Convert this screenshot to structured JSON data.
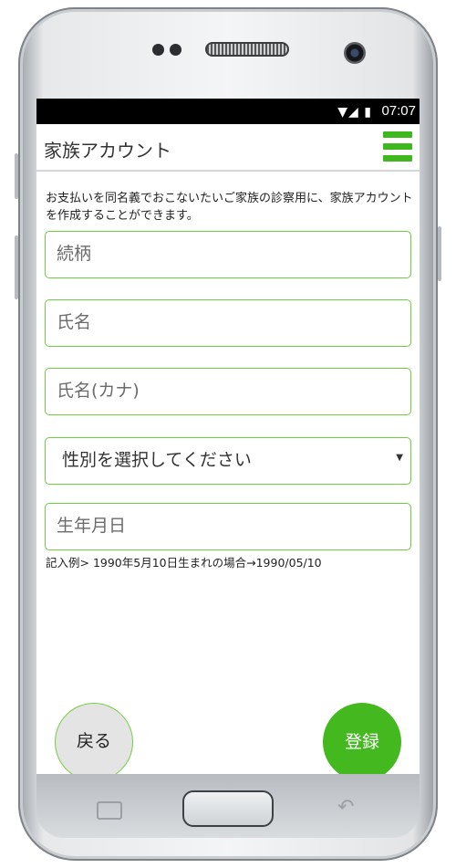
{
  "status_bar": {
    "icons": [
      "wifi-icon",
      "signal-icon",
      "battery-icon"
    ],
    "time": "07:07"
  },
  "header": {
    "title": "家族アカウント",
    "menu_icon": "hamburger-menu-icon"
  },
  "description": "お支払いを同名義でおこないたいご家族の診察用に、家族アカウントを作成することができます。",
  "form": {
    "relationship_placeholder": "続柄",
    "name_placeholder": "氏名",
    "name_kana_placeholder": "氏名(カナ)",
    "gender_select_value": "性別を選択してください",
    "birthdate_placeholder": "生年月日",
    "birthdate_hint": "記入例> 1990年5月10日生まれの場合→1990/05/10"
  },
  "buttons": {
    "back_label": "戻る",
    "register_label": "登録"
  },
  "colors": {
    "accent_green": "#43b81f",
    "field_border": "#6fcf40",
    "status_bar": "#000000"
  }
}
